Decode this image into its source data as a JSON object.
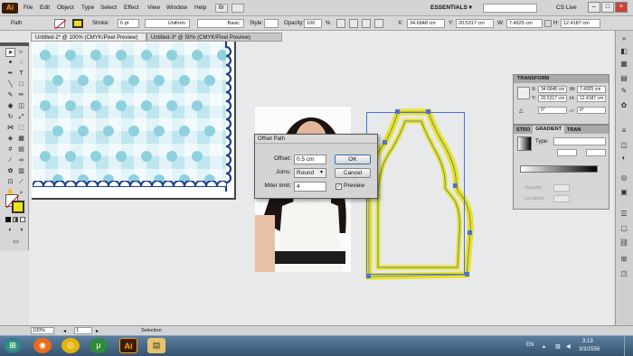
{
  "menubar": {
    "app_logo": "Ai",
    "items": [
      "File",
      "Edit",
      "Object",
      "Type",
      "Select",
      "Effect",
      "View",
      "Window",
      "Help"
    ],
    "workspace": "ESSENTIALS ▾",
    "cs_live": "CS Live"
  },
  "control": {
    "selection": "Path",
    "stroke_label": "Stroke:",
    "stroke_value": "6 pt",
    "uniform": "Uniform",
    "basic": "Basic",
    "style_label": "Style:",
    "opacity_label": "Opacity:",
    "opacity_value": "100",
    "x_label": "X:",
    "x_value": "34.6848 cm",
    "y_label": "Y:",
    "y_value": "20.5317 cm",
    "w_label": "W:",
    "w_value": "7.4925 cm",
    "h_label": "H:",
    "h_value": "12.4187 cm"
  },
  "documents": {
    "tab1": "Untitled-2* @ 100% (CMYK/Pixel Preview)",
    "tab2": "Untitled-3* @ 50% (CMYK/Pixel Preview)"
  },
  "dialog": {
    "title": "Offset Path",
    "offset_label": "Offset:",
    "offset_value": "0.5 cm",
    "joins_label": "Joins:",
    "joins_value": "Round",
    "miter_label": "Miter limit:",
    "miter_value": "4",
    "ok": "OK",
    "cancel": "Cancel",
    "preview": "Preview",
    "preview_checked": true
  },
  "transform_panel": {
    "title": "TRANSFORM",
    "x_label": "X:",
    "x": "34.6848 cm",
    "y_label": "Y:",
    "y": "20.5317 cm",
    "w_label": "W:",
    "w": "7.4925 cm",
    "h_label": "H:",
    "h": "12.4187 cm",
    "rot": "0°",
    "shear": "0°"
  },
  "gradient_panel": {
    "tab1": "STRO",
    "tab2": "GRADIENT",
    "tab3": "TRAN",
    "type_label": "Type:",
    "opacity_label": "Opacity:",
    "location_label": "Location:"
  },
  "status": {
    "zoom": "100%",
    "page": "1",
    "tool": "Selection"
  },
  "taskbar": {
    "lang": "EN",
    "time": "3:13",
    "date": "3/3/2556"
  },
  "colors": {
    "selection_blue": "#4f6fd8",
    "offset_yellow": "#e9e41a",
    "pattern_blue": "#bfe6ef"
  }
}
